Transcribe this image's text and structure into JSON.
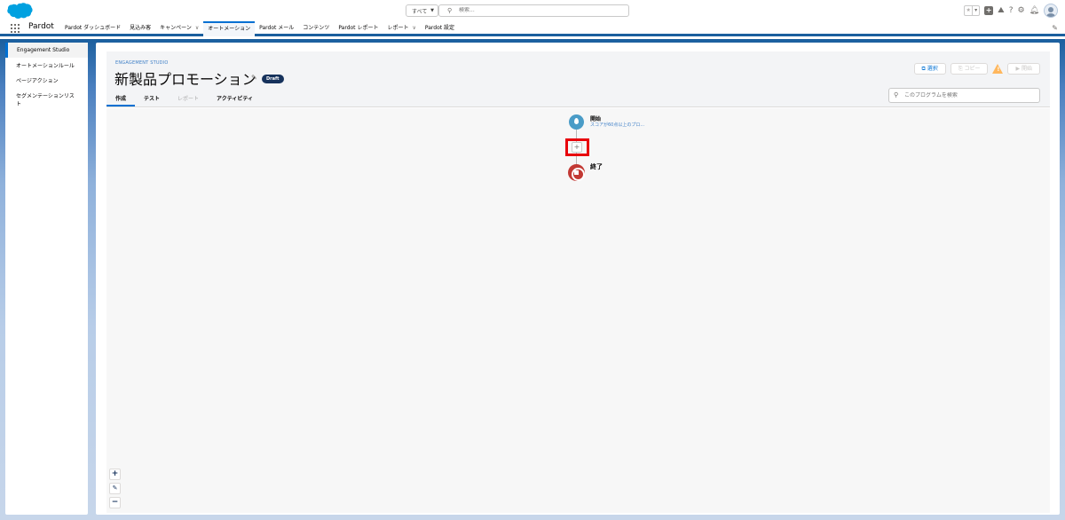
{
  "header": {
    "search_scope": "すべて",
    "search_placeholder": "検索..."
  },
  "nav": {
    "app_name": "Pardot",
    "items": [
      {
        "label": "Pardot ダッシュボード"
      },
      {
        "label": "見込み客"
      },
      {
        "label": "キャンペーン",
        "has_menu": true
      },
      {
        "label": "オートメーション",
        "active": true
      },
      {
        "label": "Pardot メール"
      },
      {
        "label": "コンテンツ"
      },
      {
        "label": "Pardot レポート"
      },
      {
        "label": "レポート",
        "has_menu": true
      },
      {
        "label": "Pardot 設定"
      }
    ]
  },
  "sidebar": {
    "items": [
      {
        "label": "Engagement Studio",
        "active": true
      },
      {
        "label": "オートメーションルール"
      },
      {
        "label": "ページアクション"
      },
      {
        "label": "セグメンテーションリスト"
      }
    ]
  },
  "page": {
    "eyebrow": "ENGAGEMENT STUDIO",
    "title": "新製品プロモーション",
    "status_badge": "Draft",
    "tabs": [
      {
        "label": "作成",
        "active": true
      },
      {
        "label": "テスト"
      },
      {
        "label": "レポート",
        "disabled": true
      },
      {
        "label": "アクティビティ"
      }
    ],
    "buttons": {
      "select": "選択",
      "copy": "コピー",
      "start": "開始"
    },
    "search_placeholder": "このプログラムを検索"
  },
  "canvas": {
    "start_label": "開始",
    "start_sub": "スコアが60点以上のプロ...",
    "add_symbol": "+",
    "end_label": "終了"
  },
  "colors": {
    "brand_blue": "#1b5f9e",
    "accent": "#0070d2",
    "start_node": "#4a9cc7",
    "end_node": "#c23934",
    "highlight": "#e8000b"
  }
}
